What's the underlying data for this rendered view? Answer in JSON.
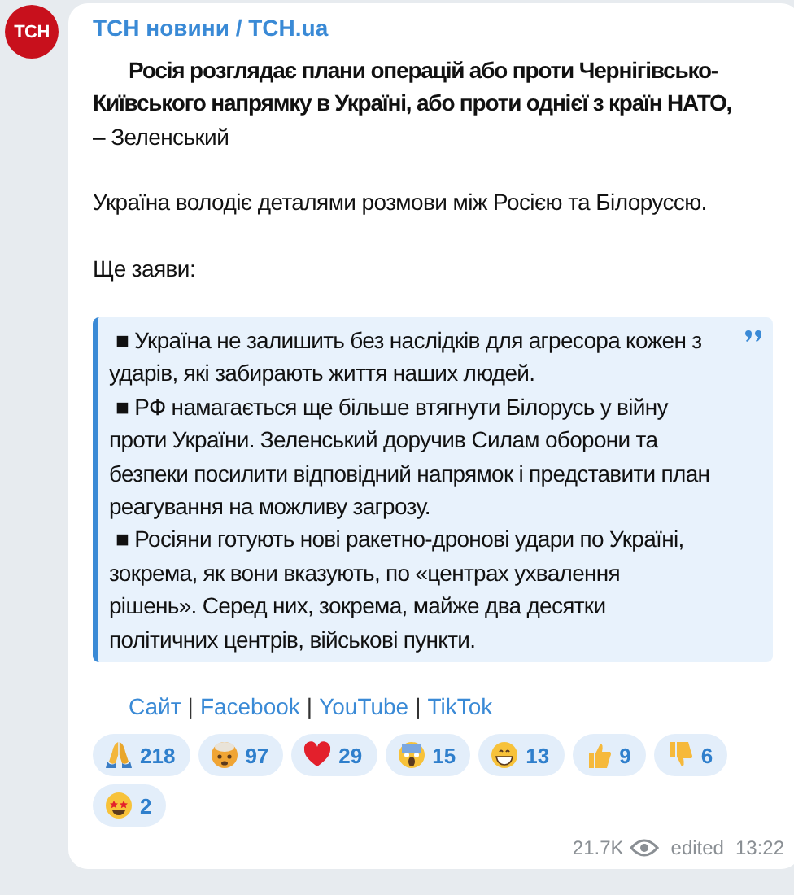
{
  "channel": {
    "avatar_text": "ТСН",
    "name": "ТСН новини / ТСН.ua"
  },
  "message": {
    "headline": "Росія розглядає плани операцій або проти Чернігівсько-Київського напрямку в Україні, або проти однієї з країн НАТО,",
    "headline_tail": "– Зеленський",
    "paragraphs": [
      "Україна володіє деталями розмови між Росією та Білоруссю.",
      "Ще заяви:"
    ],
    "quote": [
      "■ Україна не залишить без наслідків для агресора кожен з ударів, які забирають життя наших людей.",
      "■ РФ намагається ще більше втягнути Білорусь у війну проти України. Зеленський доручив Силам оборони та безпеки посилити відповідний напрямок і представити план реагування на можливу загрозу.",
      "■ Росіяни готують нові ракетно-дронові удари по Україні, зокрема, як вони вказують, по «центрах ухвалення рішень». Серед них, зокрема, майже два десятки політичних центрів, військові пункти."
    ],
    "links": [
      "Сайт",
      "Facebook",
      "YouTube",
      "TikTok"
    ],
    "separator": "|"
  },
  "reactions": [
    {
      "kind": "pray",
      "count": "218"
    },
    {
      "kind": "exploding",
      "count": "97"
    },
    {
      "kind": "heart",
      "count": "29"
    },
    {
      "kind": "scream",
      "count": "15"
    },
    {
      "kind": "grin",
      "count": "13"
    },
    {
      "kind": "thumbsup",
      "count": "9"
    },
    {
      "kind": "thumbsdown",
      "count": "6"
    },
    {
      "kind": "starstruck",
      "count": "2"
    }
  ],
  "footer": {
    "views": "21.7K",
    "edited": "edited",
    "time": "13:22"
  }
}
